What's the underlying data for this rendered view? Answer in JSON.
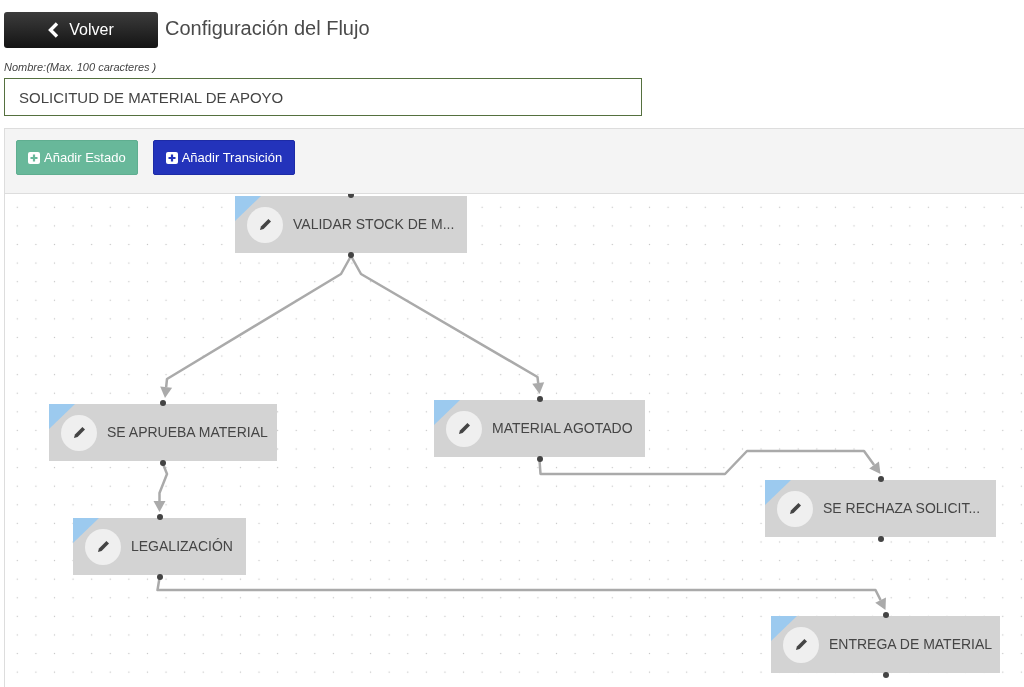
{
  "header": {
    "back_button": "Volver",
    "title": "Configuración del Flujo"
  },
  "name_field": {
    "label": "Nombre:(Max. 100 caracteres )",
    "value": "SOLICITUD DE MATERIAL DE APOYO"
  },
  "toolbar": {
    "buttons": [
      {
        "label": "Añadir Estado",
        "kind": "state"
      },
      {
        "label": "Añadir Transición",
        "kind": "transition"
      }
    ]
  },
  "canvas": {
    "states": [
      {
        "label": "VALIDAR STOCK DE M..."
      },
      {
        "label": "SE APRUEBA MATERIAL"
      },
      {
        "label": "MATERIAL AGOTADO"
      },
      {
        "label": "SE RECHAZA SOLICIT..."
      },
      {
        "label": "LEGALIZACIÓN"
      },
      {
        "label": "ENTREGA DE MATERIAL"
      }
    ]
  }
}
